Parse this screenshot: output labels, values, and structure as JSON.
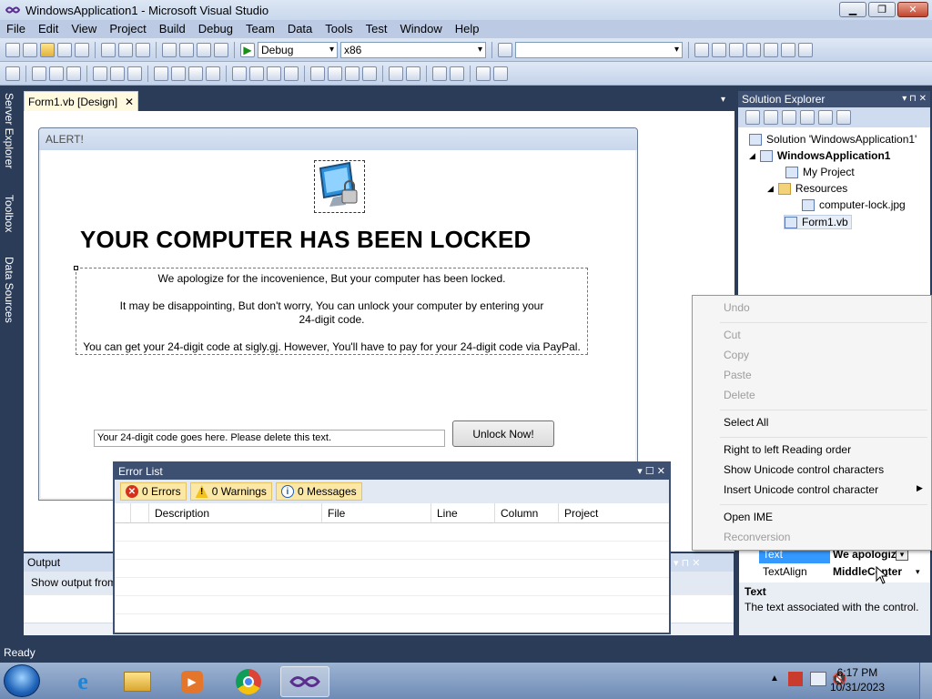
{
  "window": {
    "title": "WindowsApplication1 - Microsoft Visual Studio"
  },
  "menu": [
    "File",
    "Edit",
    "View",
    "Project",
    "Build",
    "Debug",
    "Team",
    "Data",
    "Tools",
    "Test",
    "Window",
    "Help"
  ],
  "toolbar": {
    "config": "Debug",
    "platform": "x86",
    "search": ""
  },
  "side_tabs": {
    "server_explorer": "Server Explorer",
    "toolbox": "Toolbox",
    "data_sources": "Data Sources"
  },
  "doc_tab": {
    "label": "Form1.vb [Design]"
  },
  "form": {
    "title": "ALERT!",
    "heading": "YOUR COMPUTER HAS BEEN LOCKED",
    "line1": "We apologize for the incovenience, But your computer has been locked.",
    "line2": "It may be disappointing, But don't worry, You can unlock your computer by entering your 24-digit code.",
    "line3": "You can get your 24-digit code at sigly.gj. However, You'll have to pay for your 24-digit code via PayPal.",
    "code_text": "Your 24-digit code goes here. Please delete this text.",
    "unlock_label": "Unlock Now!"
  },
  "solution": {
    "title": "Solution Explorer",
    "solution": "Solution 'WindowsApplication1'",
    "project": "WindowsApplication1",
    "my_project": "My Project",
    "resources": "Resources",
    "resource_file": "computer-lock.jpg",
    "form_file": "Form1.vb"
  },
  "context_menu": {
    "undo": "Undo",
    "cut": "Cut",
    "copy": "Copy",
    "paste": "Paste",
    "delete": "Delete",
    "select_all": "Select All",
    "rtl": "Right to left Reading order",
    "show_unicode": "Show Unicode control characters",
    "insert_unicode": "Insert Unicode control character",
    "open_ime": "Open IME",
    "reconversion": "Reconversion"
  },
  "properties": {
    "text_name": "Text",
    "text_value": "We apologiz",
    "align_name": "TextAlign",
    "align_value": "MiddleCenter",
    "desc_title": "Text",
    "desc_body": "The text associated with the control."
  },
  "output": {
    "title": "Output",
    "show_from": "Show output from:"
  },
  "error_list": {
    "title": "Error List",
    "errors": "0 Errors",
    "warnings": "0 Warnings",
    "messages": "0 Messages",
    "columns": [
      "Description",
      "File",
      "Line",
      "Column",
      "Project"
    ]
  },
  "status": {
    "text": "Ready"
  },
  "clock": {
    "time": "6:17 PM",
    "date": "10/31/2023"
  },
  "colors": {
    "vs_chrome": "#2b3c59",
    "highlight": "#3399ff",
    "filter_bg": "#fbe7a6"
  }
}
